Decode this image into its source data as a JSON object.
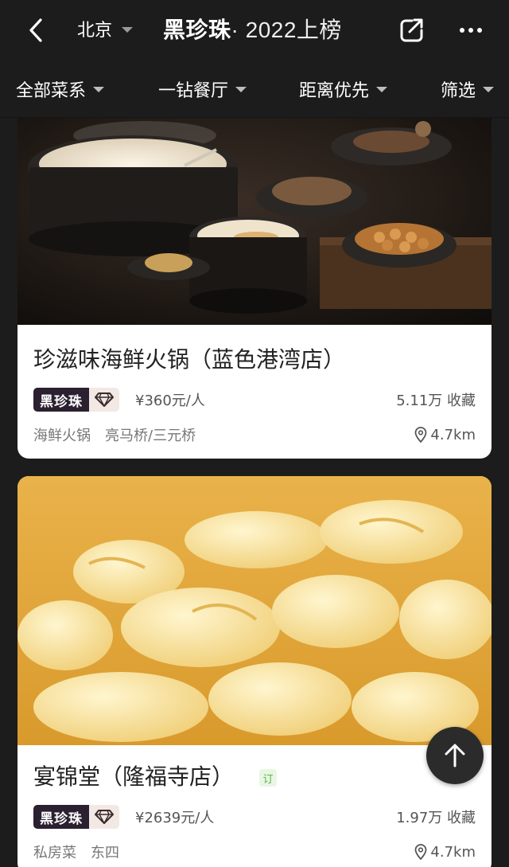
{
  "header": {
    "city": "北京",
    "title_brand": "黑珍珠",
    "title_rest": " · 2022上榜"
  },
  "filters": [
    "全部菜系",
    "一钻餐厅",
    "距离优先",
    "筛选"
  ],
  "restaurants": [
    {
      "name": "珍滋味海鲜火锅（蓝色港湾店）",
      "badge": "黑珍珠",
      "price": "¥360元/人",
      "favorites": "5.11万 收藏",
      "cuisine": "海鲜火锅",
      "area": "亮马桥/三元桥",
      "distance": "4.7km",
      "photo_icon": "seafood-hotpot-photo"
    },
    {
      "name": "宴锦堂（隆福寺店）",
      "reserve_tag": "订",
      "badge": "黑珍珠",
      "price": "¥2639元/人",
      "favorites": "1.97万 收藏",
      "cuisine": "私房菜",
      "area": "东四",
      "distance": "4.7km",
      "photo_icon": "fish-maw-soup-photo"
    }
  ],
  "colors": {
    "background": "#1c1c1c",
    "card": "#ffffff",
    "badge_dark": "#2a2030",
    "badge_light": "#f2e8e4",
    "reserve_green": "#5fb04c"
  }
}
